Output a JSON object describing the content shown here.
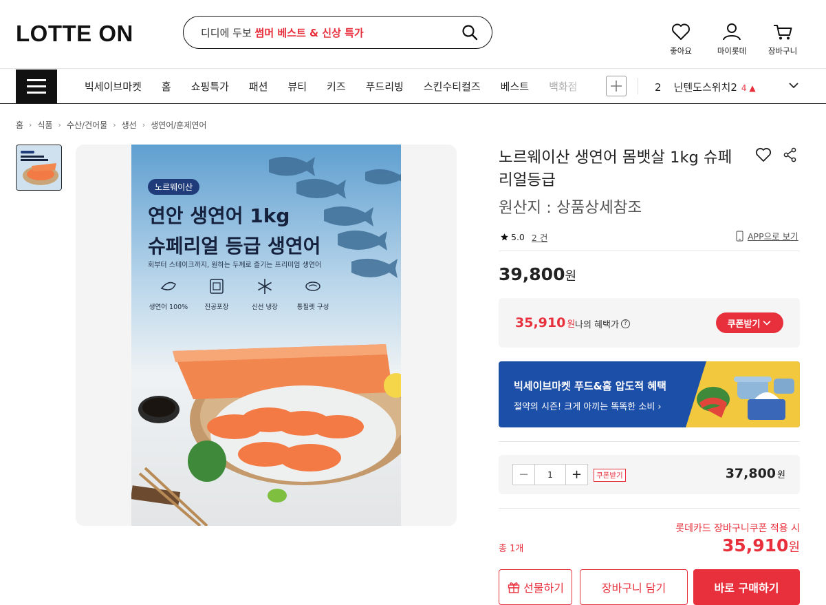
{
  "header": {
    "logo": "LOTTE ON",
    "search": {
      "prefix": "디디에 두보 ",
      "highlight": "썸머 베스트 & 신상 특가"
    },
    "icons": [
      {
        "name": "heart-icon",
        "label": "좋아요"
      },
      {
        "name": "user-icon",
        "label": "마이롯데"
      },
      {
        "name": "cart-icon",
        "label": "장바구니"
      }
    ]
  },
  "nav": {
    "items": [
      "빅세이브마켓",
      "홈",
      "쇼핑특가",
      "패션",
      "뷰티",
      "키즈",
      "푸드리빙",
      "스킨수티컬즈",
      "베스트",
      "백화점"
    ],
    "ranking": {
      "rank": "2",
      "keyword": "닌텐도스위치2",
      "change": "4 ▲"
    }
  },
  "breadcrumb": [
    "홈",
    "식품",
    "수산/건어물",
    "생선",
    "생연어/훈제연어"
  ],
  "product_image": {
    "badge": "노르웨이산",
    "title_line1": "연안 생연어 1kg",
    "title_line2": "슈페리얼 등급 생연어",
    "subtitle": "회부터 스테이크까지, 원하는 두께로 즐기는 프리미엄 생연어",
    "features": [
      "생연어 100%",
      "진공포장",
      "신선 냉장",
      "통필렛 구성"
    ]
  },
  "product": {
    "title": "노르웨이산 생연어 몸뱃살 1kg 슈페리얼등급",
    "origin": "원산지 : 상품상세참조",
    "rating": "5.0",
    "review_count": "2 건",
    "app_link": "APP으로 보기",
    "price": "39,800",
    "price_unit": "원"
  },
  "benefit": {
    "price": "35,910",
    "unit": "원",
    "label": "나의 혜택가",
    "coupon_button": "쿠폰받기"
  },
  "promo": {
    "title": "빅세이브마켓 푸드&홈 압도적 혜택",
    "subtitle": "절약의 시즌! 크게 아끼는 똑똑한 소비 ›"
  },
  "option": {
    "quantity": "1",
    "coupon_tag": "쿠폰받기",
    "price": "37,800",
    "unit": "원"
  },
  "summary": {
    "card_note": "롯데카드 장바구니쿠폰 적용 시",
    "total_label": "총 1개",
    "total_price": "35,910",
    "unit": "원"
  },
  "buttons": {
    "gift": "선물하기",
    "cart": "장바구니 담기",
    "buy": "바로 구매하기"
  },
  "colors": {
    "accent": "#e8303d",
    "promo_bg": "#1c4fa8",
    "image_badge": "#1f3b7a"
  }
}
